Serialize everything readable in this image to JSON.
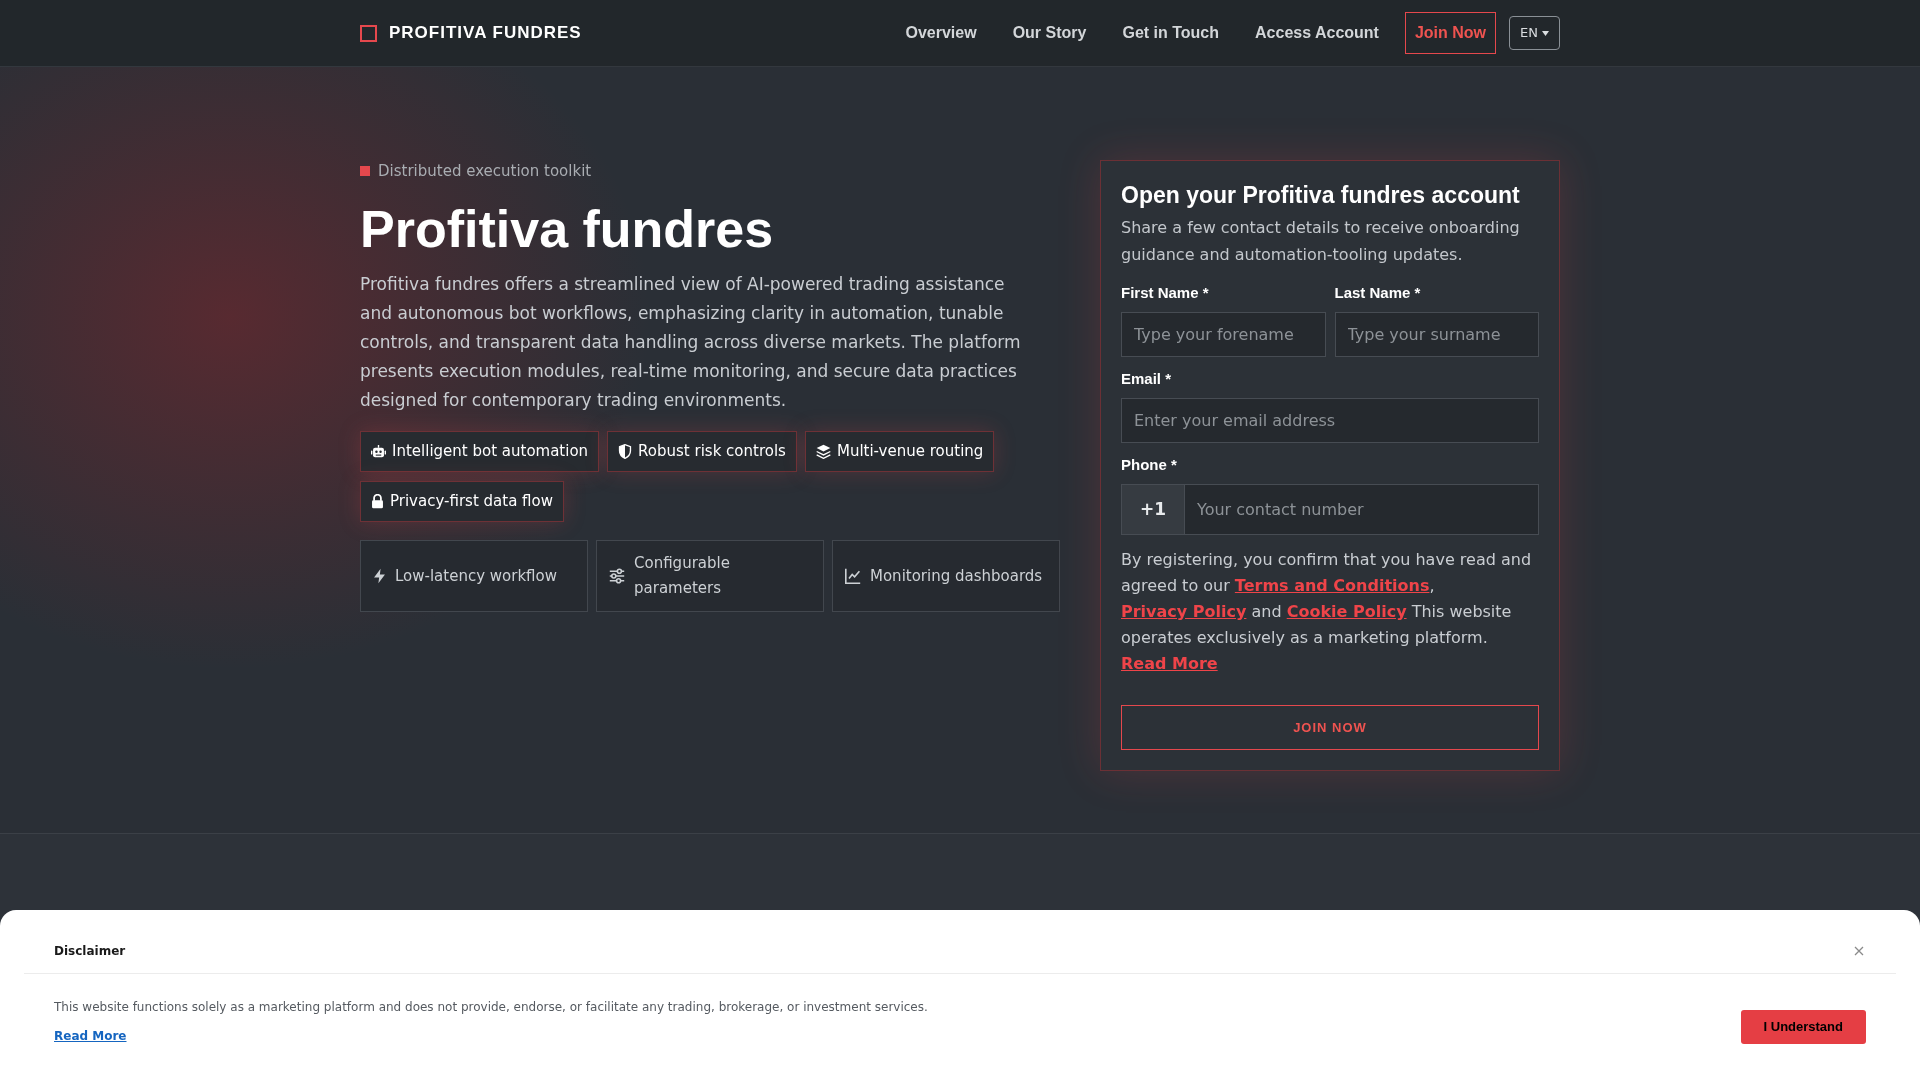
{
  "header": {
    "brand": "PROFITIVA FUNDRES",
    "nav": [
      {
        "label": "Overview"
      },
      {
        "label": "Our Story"
      },
      {
        "label": "Get in Touch"
      },
      {
        "label": "Access Account"
      }
    ],
    "join_button": "Join Now",
    "language": "EN"
  },
  "hero": {
    "eyebrow": "Distributed execution toolkit",
    "title": "Profitiva fundres",
    "description": "Profitiva fundres offers a streamlined view of AI-powered trading assistance and autonomous bot workflows, emphasizing clarity in automation, tunable controls, and transparent data handling across diverse markets. The platform presents execution modules, real-time monitoring, and secure data practices designed for contemporary trading environments.",
    "tags": [
      {
        "label": "Intelligent bot automation"
      },
      {
        "label": "Robust risk controls"
      },
      {
        "label": "Multi-venue routing"
      },
      {
        "label": "Privacy-first data flow"
      }
    ],
    "features": [
      {
        "label": "Low-latency workflow"
      },
      {
        "label": "Configurable parameters"
      },
      {
        "label": "Monitoring dashboards"
      }
    ]
  },
  "signup_form": {
    "title": "Open your Profitiva fundres account",
    "subtitle": "Share a few contact details to receive onboarding guidance and automation-tooling updates.",
    "name_fields": [
      {
        "label": "First Name *",
        "placeholder": "Type your forename"
      },
      {
        "label": "Last Name *",
        "placeholder": "Type your surname"
      }
    ],
    "email": {
      "label": "Email *",
      "placeholder": "Enter your email address"
    },
    "phone": {
      "label": "Phone *",
      "prefix": "+1",
      "placeholder": "Your contact number"
    },
    "consent": [
      {
        "kind": "text",
        "text": "By registering, you confirm that you have read and agreed to our "
      },
      {
        "kind": "link",
        "text": "Terms and Conditions"
      },
      {
        "kind": "text",
        "text": ", "
      },
      {
        "kind": "link",
        "text": "Privacy Policy"
      },
      {
        "kind": "text",
        "text": " and "
      },
      {
        "kind": "link",
        "text": "Cookie Policy"
      },
      {
        "kind": "text",
        "text": " This website operates exclusively as a marketing platform. "
      },
      {
        "kind": "link",
        "text": "Read More"
      }
    ],
    "submit": "JOIN NOW"
  },
  "disclaimer": {
    "title": "Disclaimer",
    "text": "This website functions solely as a marketing platform and does not provide, endorse, or facilitate any trading, brokerage, or investment services.",
    "link": "Read More",
    "button": "I Understand"
  }
}
